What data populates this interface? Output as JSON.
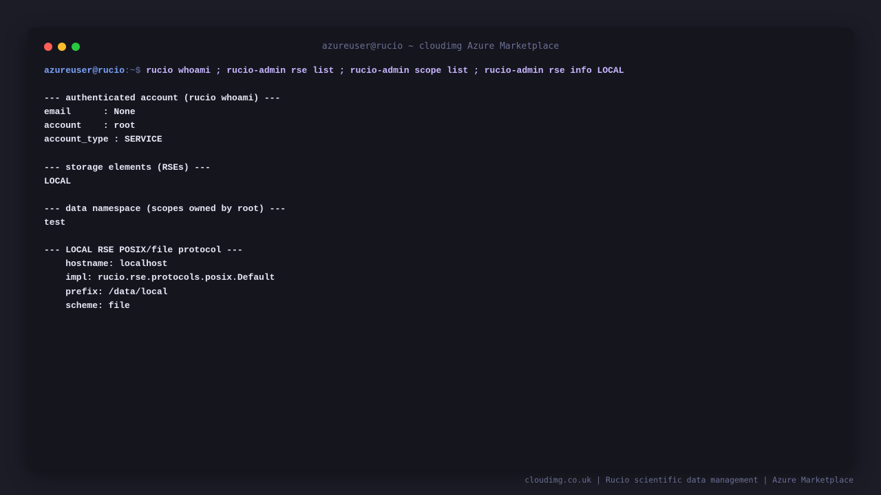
{
  "window": {
    "title": "azureuser@rucio ~ cloudimg Azure Marketplace"
  },
  "terminal": {
    "prompt_user": "azureuser@rucio",
    "prompt_path": ":~$ ",
    "command": "rucio whoami ; rucio-admin rse list ; rucio-admin scope list ; rucio-admin rse info LOCAL",
    "lines": [
      "",
      "--- authenticated account (rucio whoami) ---",
      "email      : None",
      "account    : root",
      "account_type : SERVICE",
      "",
      "--- storage elements (RSEs) ---",
      "LOCAL",
      "",
      "--- data namespace (scopes owned by root) ---",
      "test",
      "",
      "--- LOCAL RSE POSIX/file protocol ---",
      "    hostname: localhost",
      "    impl: rucio.rse.protocols.posix.Default",
      "    prefix: /data/local",
      "    scheme: file"
    ]
  },
  "footer": {
    "text": "cloudimg.co.uk | Rucio scientific data management | Azure Marketplace"
  },
  "colors": {
    "background": "#1c1c27",
    "window": "#15151e",
    "prompt_user": "#7aa2f7",
    "command": "#c8b6ff",
    "output": "#e4e6f4",
    "close": "#ff5f57",
    "minimize": "#febc2e",
    "maximize": "#28c840"
  }
}
